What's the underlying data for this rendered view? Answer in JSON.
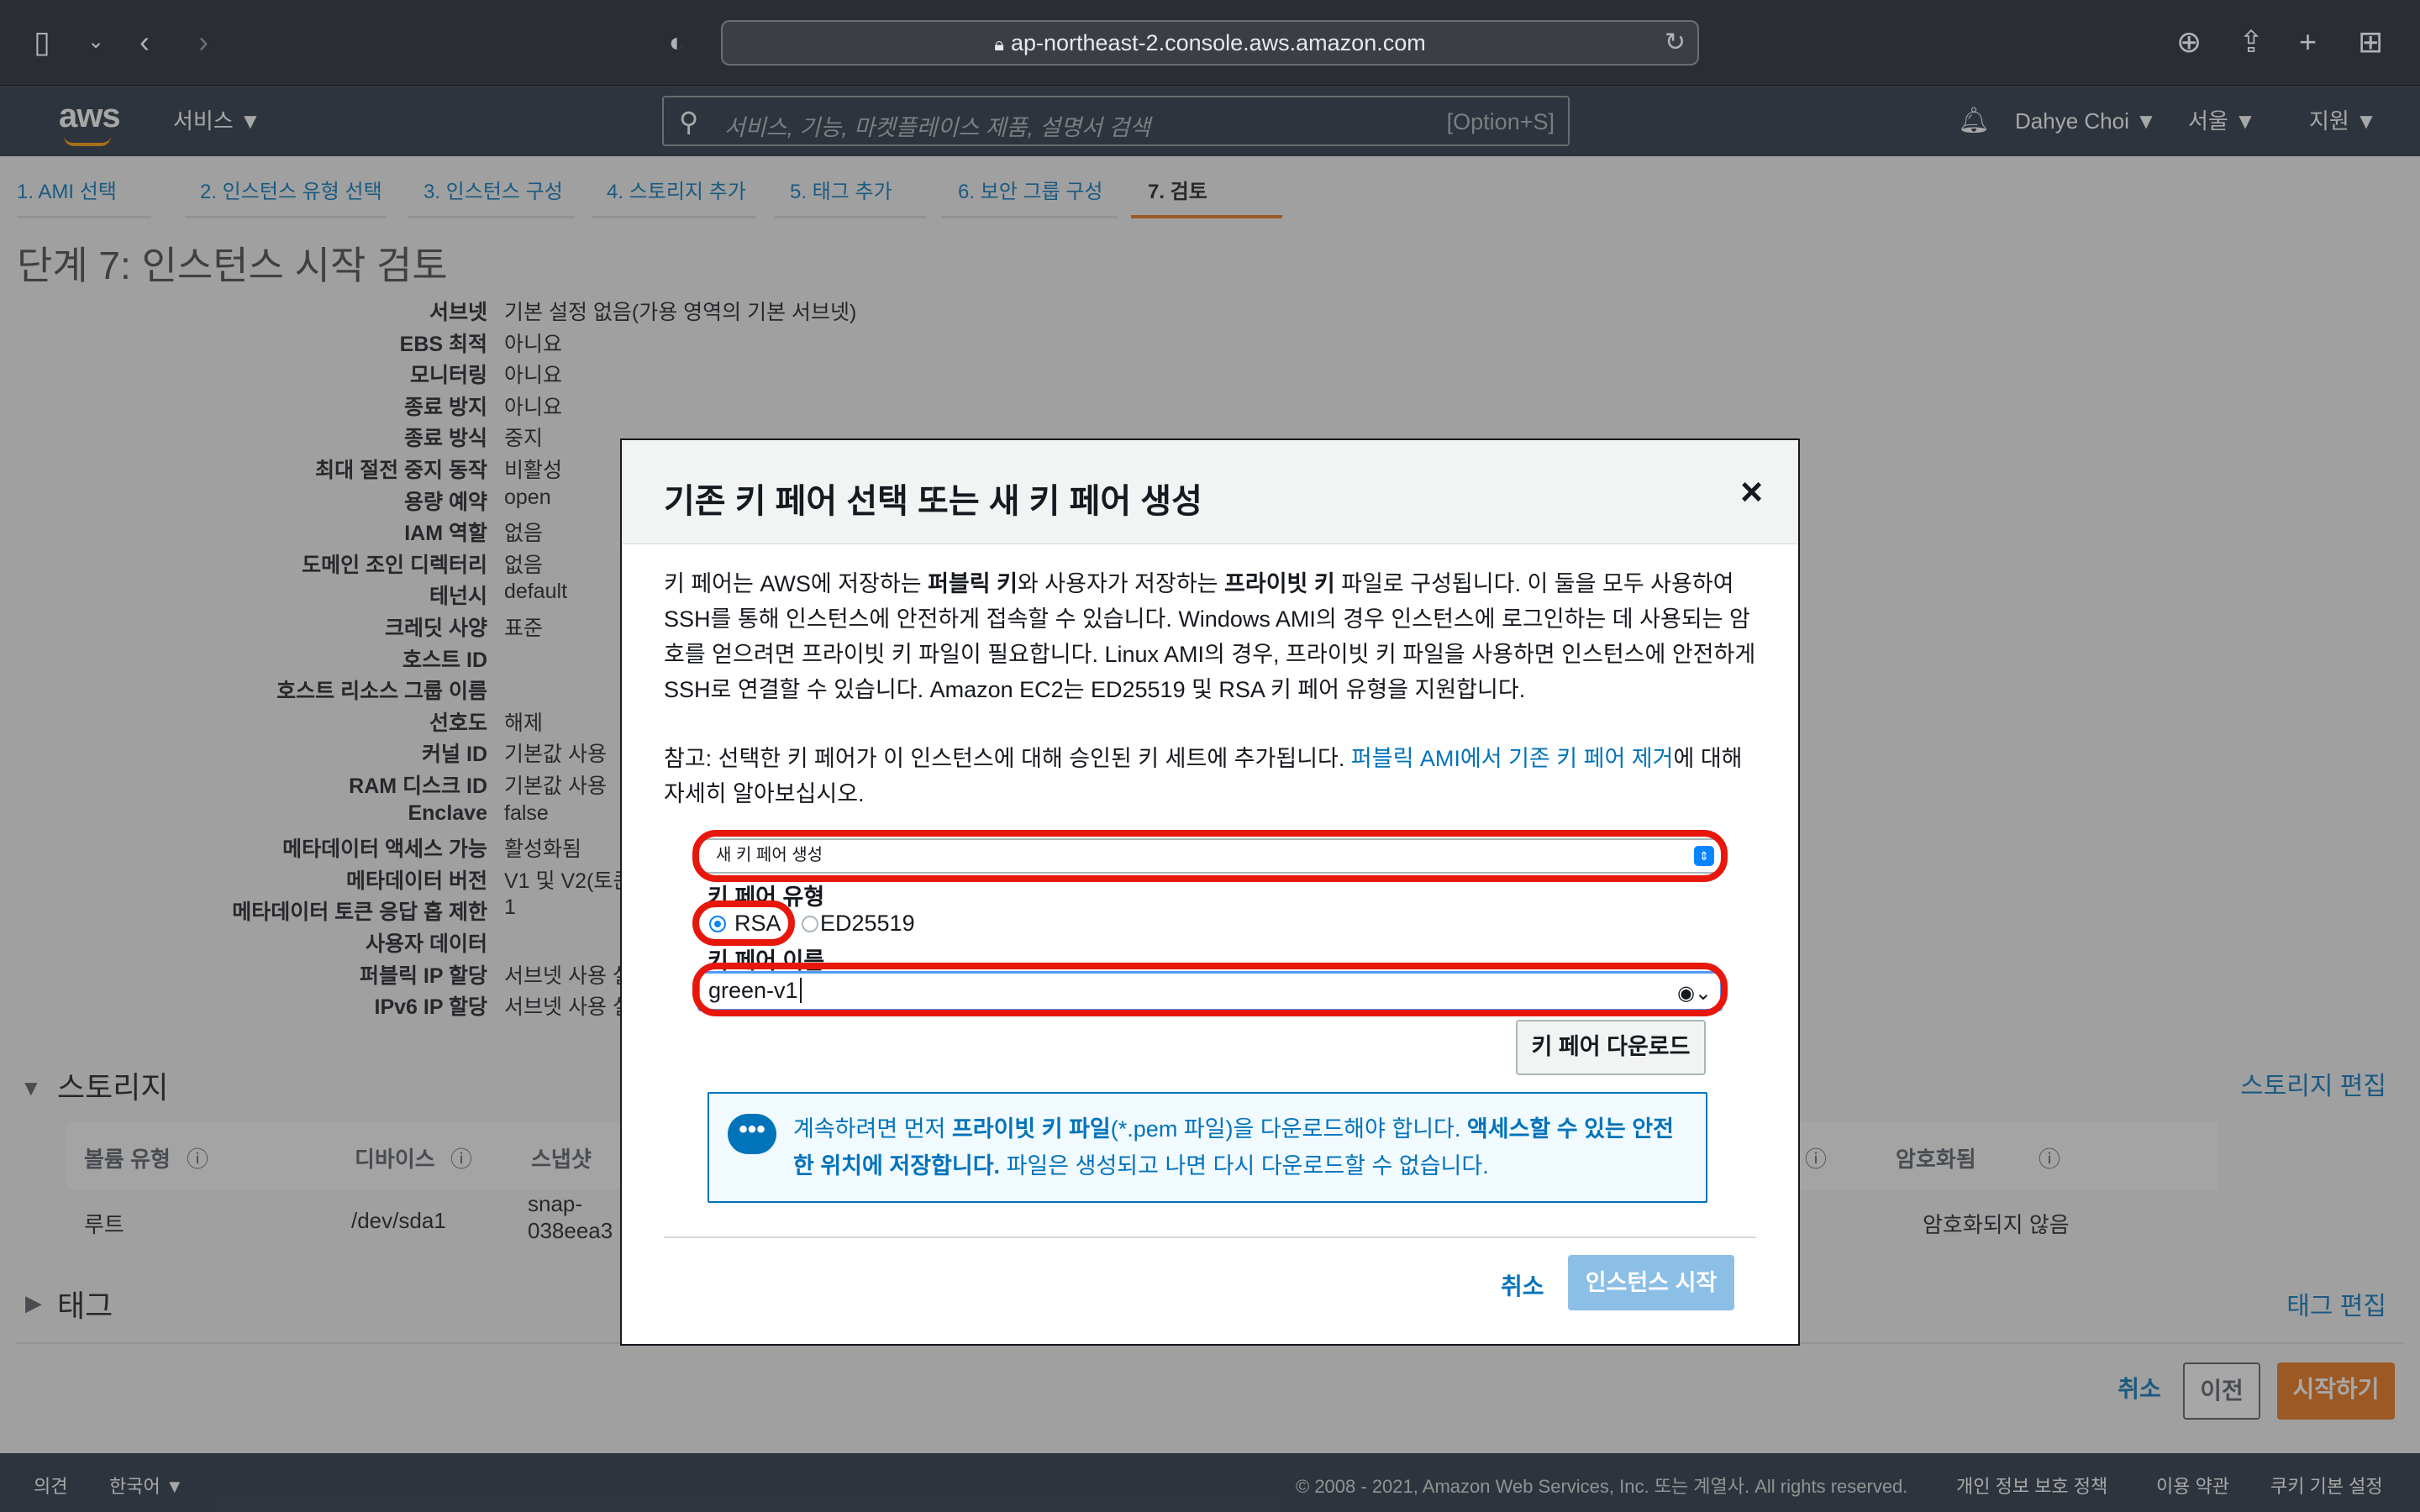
{
  "browser": {
    "url": "ap-northeast-2.console.aws.amazon.com"
  },
  "aws_nav": {
    "logo": "aws",
    "services": "서비스 ▼",
    "search_placeholder": "서비스, 기능, 마켓플레이스 제품, 설명서 검색",
    "search_shortcut": "[Option+S]",
    "user": "Dahye Choi ▼",
    "region": "서울 ▼",
    "support": "지원 ▼"
  },
  "wizard_tabs": [
    "1. AMI 선택",
    "2. 인스턴스 유형 선택",
    "3. 인스턴스 구성",
    "4. 스토리지 추가",
    "5. 태그 추가",
    "6. 보안 그룹 구성",
    "7. 검토"
  ],
  "page_title": "단계 7: 인스턴스 시작 검토",
  "details": [
    {
      "label": "서브넷",
      "value": "기본 설정 없음(가용 영역의 기본 서브넷)"
    },
    {
      "label": "EBS 최적",
      "value": "아니요"
    },
    {
      "label": "모니터링",
      "value": "아니요"
    },
    {
      "label": "종료 방지",
      "value": "아니요"
    },
    {
      "label": "종료 방식",
      "value": "중지"
    },
    {
      "label": "최대 절전 중지 동작",
      "value": "비활성"
    },
    {
      "label": "용량 예약",
      "value": "open"
    },
    {
      "label": "IAM 역할",
      "value": "없음"
    },
    {
      "label": "도메인 조인 디렉터리",
      "value": "없음"
    },
    {
      "label": "테넌시",
      "value": "default"
    },
    {
      "label": "크레딧 사양",
      "value": "표준"
    },
    {
      "label": "호스트 ID",
      "value": ""
    },
    {
      "label": "호스트 리소스 그룹 이름",
      "value": ""
    },
    {
      "label": "선호도",
      "value": "해제"
    },
    {
      "label": "커널 ID",
      "value": "기본값 사용"
    },
    {
      "label": "RAM 디스크 ID",
      "value": "기본값 사용"
    },
    {
      "label": "Enclave",
      "value": "false"
    },
    {
      "label": "메타데이터 액세스 가능",
      "value": "활성화됨"
    },
    {
      "label": "메타데이터 버전",
      "value": "V1 및 V2(토큰"
    },
    {
      "label": "메타데이터 토큰 응답 홉 제한",
      "value": "1"
    },
    {
      "label": "사용자 데이터",
      "value": ""
    },
    {
      "label": "퍼블릭 IP 할당",
      "value": "서브넷 사용 설"
    },
    {
      "label": "IPv6 IP 할당",
      "value": "서브넷 사용 설"
    }
  ],
  "storage": {
    "title": "스토리지",
    "edit": "스토리지 편집",
    "headers": {
      "volume_type": "볼륨 유형",
      "device": "디바이스",
      "snapshot": "스냅샷",
      "encrypted": "암호화됨"
    },
    "row": {
      "volume_type": "루트",
      "device": "/dev/sda1",
      "snapshot_1": "snap-",
      "snapshot_2": "038eea3",
      "encrypted": "암호화되지 않음"
    }
  },
  "tags": {
    "title": "태그",
    "edit": "태그 편집"
  },
  "bottom_actions": {
    "cancel": "취소",
    "previous": "이전",
    "launch": "시작하기"
  },
  "footer": {
    "feedback": "의견",
    "language": "한국어 ▼",
    "copyright": "© 2008 - 2021, Amazon Web Services, Inc. 또는 계열사. All rights reserved.",
    "privacy": "개인 정보 보호 정책",
    "terms": "이용 약관",
    "cookies": "쿠키 기본 설정"
  },
  "modal": {
    "title": "기존 키 페어 선택 또는 새 키 페어 생성",
    "close": "×",
    "para1_a": "키 페어는 AWS에 저장하는 ",
    "para1_b": "퍼블릭 키",
    "para1_c": "와 사용자가 저장하는 ",
    "para1_d": "프라이빗 키",
    "para1_e": " 파일로 구성됩니다. 이 둘을 모두 사용하여 SSH를 통해 인스턴스에 안전하게 접속할 수 있습니다. Windows AMI의 경우 인스턴스에 로그인하는 데 사용되는 암호를 얻으려면 프라이빗 키 파일이 필요합니다. Linux AMI의 경우, 프라이빗 키 파일을 사용하면 인스턴스에 안전하게 SSH로 연결할 수 있습니다. Amazon EC2는 ED25519 및 RSA 키 페어 유형을 지원합니다.",
    "para2_a": "참고: 선택한 키 페어가 이 인스턴스에 대해 승인된 키 세트에 추가됩니다. ",
    "para2_link": "퍼블릭 AMI에서 기존 키 페어 제거",
    "para2_b": "에 대해 자세히 알아보십시오.",
    "select_value": "새 키 페어 생성",
    "key_type_label": "키 페어 유형",
    "key_type_rsa": "RSA",
    "key_type_ed": "ED25519",
    "key_name_label": "키 페어 이름",
    "key_name_value": "green-v1",
    "download_button": "키 페어 다운로드",
    "info_a": "계속하려면 먼저 ",
    "info_b": "프라이빗 키 파일",
    "info_c": "(*.pem 파일)을 다운로드해야 합니다. ",
    "info_d": "액세스할 수 있는 안전한 위치에 저장합니다.",
    "info_e": " 파일은 생성되고 나면 다시 다운로드할 수 없습니다.",
    "cancel": "취소",
    "launch": "인스턴스 시작"
  },
  "colors": {
    "highlight": "#e8170c",
    "link": "#0073bb",
    "nav_bg": "#232f3e"
  }
}
